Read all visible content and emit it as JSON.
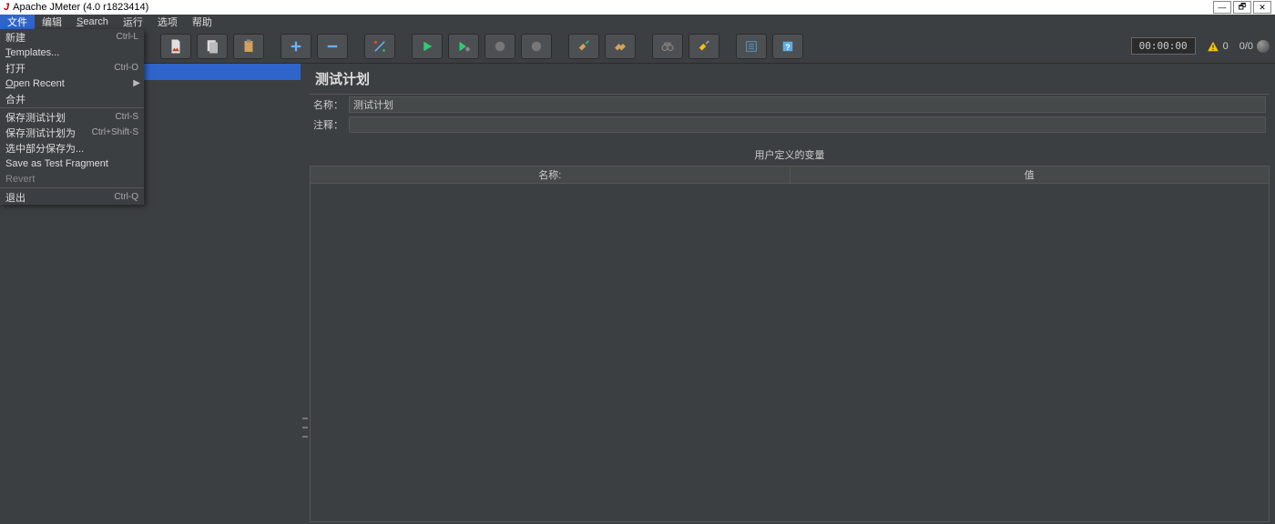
{
  "window": {
    "title": "Apache JMeter (4.0 r1823414)"
  },
  "menubar": {
    "items": [
      {
        "label": "文件",
        "active": true
      },
      {
        "label": "编辑"
      },
      {
        "label": "Search"
      },
      {
        "label": "运行"
      },
      {
        "label": "选项"
      },
      {
        "label": "帮助"
      }
    ]
  },
  "file_menu": {
    "items": [
      {
        "label": "新建",
        "shortcut": "Ctrl-L",
        "enabled": true
      },
      {
        "label": "Templates...",
        "shortcut": "",
        "enabled": true
      },
      {
        "label": "打开",
        "shortcut": "Ctrl-O",
        "enabled": true
      },
      {
        "label": "Open Recent",
        "shortcut": "",
        "enabled": true,
        "submenu": true
      },
      {
        "label": "合并",
        "shortcut": "",
        "enabled": true
      },
      {
        "label": "保存测试计划",
        "shortcut": "Ctrl-S",
        "enabled": true,
        "sep_before": true
      },
      {
        "label": "保存测试计划为",
        "shortcut": "Ctrl+Shift-S",
        "enabled": true
      },
      {
        "label": "选中部分保存为...",
        "shortcut": "",
        "enabled": true
      },
      {
        "label": "Save as Test Fragment",
        "shortcut": "",
        "enabled": true
      },
      {
        "label": "Revert",
        "shortcut": "",
        "enabled": false
      },
      {
        "label": "退出",
        "shortcut": "Ctrl-Q",
        "enabled": true,
        "sep_before": true
      }
    ]
  },
  "toolbar_status": {
    "timer": "00:00:00",
    "warn_count": "0",
    "thread_status": "0/0"
  },
  "main": {
    "panel_title": "测试计划",
    "name_label": "名称：",
    "name_value": "测试计划",
    "comment_label": "注释：",
    "comment_value": "",
    "vars_section_title": "用户定义的变量",
    "vars_col_name": "名称:",
    "vars_col_value": "值"
  }
}
